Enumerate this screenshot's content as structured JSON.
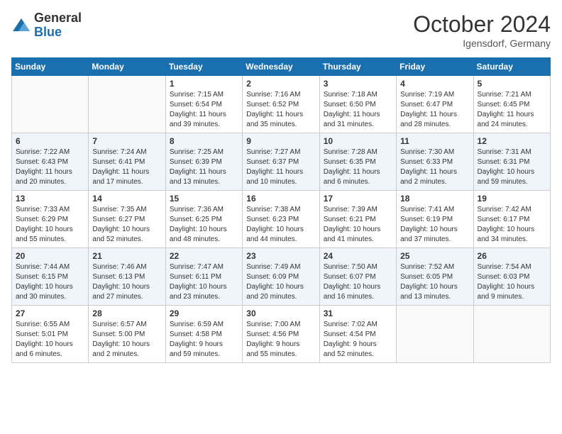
{
  "header": {
    "logo": {
      "general": "General",
      "blue": "Blue"
    },
    "title": "October 2024",
    "location": "Igensdorf, Germany"
  },
  "calendar": {
    "days_of_week": [
      "Sunday",
      "Monday",
      "Tuesday",
      "Wednesday",
      "Thursday",
      "Friday",
      "Saturday"
    ],
    "weeks": [
      [
        {
          "day": "",
          "info": ""
        },
        {
          "day": "",
          "info": ""
        },
        {
          "day": "1",
          "info": "Sunrise: 7:15 AM\nSunset: 6:54 PM\nDaylight: 11 hours\nand 39 minutes."
        },
        {
          "day": "2",
          "info": "Sunrise: 7:16 AM\nSunset: 6:52 PM\nDaylight: 11 hours\nand 35 minutes."
        },
        {
          "day": "3",
          "info": "Sunrise: 7:18 AM\nSunset: 6:50 PM\nDaylight: 11 hours\nand 31 minutes."
        },
        {
          "day": "4",
          "info": "Sunrise: 7:19 AM\nSunset: 6:47 PM\nDaylight: 11 hours\nand 28 minutes."
        },
        {
          "day": "5",
          "info": "Sunrise: 7:21 AM\nSunset: 6:45 PM\nDaylight: 11 hours\nand 24 minutes."
        }
      ],
      [
        {
          "day": "6",
          "info": "Sunrise: 7:22 AM\nSunset: 6:43 PM\nDaylight: 11 hours\nand 20 minutes."
        },
        {
          "day": "7",
          "info": "Sunrise: 7:24 AM\nSunset: 6:41 PM\nDaylight: 11 hours\nand 17 minutes."
        },
        {
          "day": "8",
          "info": "Sunrise: 7:25 AM\nSunset: 6:39 PM\nDaylight: 11 hours\nand 13 minutes."
        },
        {
          "day": "9",
          "info": "Sunrise: 7:27 AM\nSunset: 6:37 PM\nDaylight: 11 hours\nand 10 minutes."
        },
        {
          "day": "10",
          "info": "Sunrise: 7:28 AM\nSunset: 6:35 PM\nDaylight: 11 hours\nand 6 minutes."
        },
        {
          "day": "11",
          "info": "Sunrise: 7:30 AM\nSunset: 6:33 PM\nDaylight: 11 hours\nand 2 minutes."
        },
        {
          "day": "12",
          "info": "Sunrise: 7:31 AM\nSunset: 6:31 PM\nDaylight: 10 hours\nand 59 minutes."
        }
      ],
      [
        {
          "day": "13",
          "info": "Sunrise: 7:33 AM\nSunset: 6:29 PM\nDaylight: 10 hours\nand 55 minutes."
        },
        {
          "day": "14",
          "info": "Sunrise: 7:35 AM\nSunset: 6:27 PM\nDaylight: 10 hours\nand 52 minutes."
        },
        {
          "day": "15",
          "info": "Sunrise: 7:36 AM\nSunset: 6:25 PM\nDaylight: 10 hours\nand 48 minutes."
        },
        {
          "day": "16",
          "info": "Sunrise: 7:38 AM\nSunset: 6:23 PM\nDaylight: 10 hours\nand 44 minutes."
        },
        {
          "day": "17",
          "info": "Sunrise: 7:39 AM\nSunset: 6:21 PM\nDaylight: 10 hours\nand 41 minutes."
        },
        {
          "day": "18",
          "info": "Sunrise: 7:41 AM\nSunset: 6:19 PM\nDaylight: 10 hours\nand 37 minutes."
        },
        {
          "day": "19",
          "info": "Sunrise: 7:42 AM\nSunset: 6:17 PM\nDaylight: 10 hours\nand 34 minutes."
        }
      ],
      [
        {
          "day": "20",
          "info": "Sunrise: 7:44 AM\nSunset: 6:15 PM\nDaylight: 10 hours\nand 30 minutes."
        },
        {
          "day": "21",
          "info": "Sunrise: 7:46 AM\nSunset: 6:13 PM\nDaylight: 10 hours\nand 27 minutes."
        },
        {
          "day": "22",
          "info": "Sunrise: 7:47 AM\nSunset: 6:11 PM\nDaylight: 10 hours\nand 23 minutes."
        },
        {
          "day": "23",
          "info": "Sunrise: 7:49 AM\nSunset: 6:09 PM\nDaylight: 10 hours\nand 20 minutes."
        },
        {
          "day": "24",
          "info": "Sunrise: 7:50 AM\nSunset: 6:07 PM\nDaylight: 10 hours\nand 16 minutes."
        },
        {
          "day": "25",
          "info": "Sunrise: 7:52 AM\nSunset: 6:05 PM\nDaylight: 10 hours\nand 13 minutes."
        },
        {
          "day": "26",
          "info": "Sunrise: 7:54 AM\nSunset: 6:03 PM\nDaylight: 10 hours\nand 9 minutes."
        }
      ],
      [
        {
          "day": "27",
          "info": "Sunrise: 6:55 AM\nSunset: 5:01 PM\nDaylight: 10 hours\nand 6 minutes."
        },
        {
          "day": "28",
          "info": "Sunrise: 6:57 AM\nSunset: 5:00 PM\nDaylight: 10 hours\nand 2 minutes."
        },
        {
          "day": "29",
          "info": "Sunrise: 6:59 AM\nSunset: 4:58 PM\nDaylight: 9 hours\nand 59 minutes."
        },
        {
          "day": "30",
          "info": "Sunrise: 7:00 AM\nSunset: 4:56 PM\nDaylight: 9 hours\nand 55 minutes."
        },
        {
          "day": "31",
          "info": "Sunrise: 7:02 AM\nSunset: 4:54 PM\nDaylight: 9 hours\nand 52 minutes."
        },
        {
          "day": "",
          "info": ""
        },
        {
          "day": "",
          "info": ""
        }
      ]
    ]
  }
}
